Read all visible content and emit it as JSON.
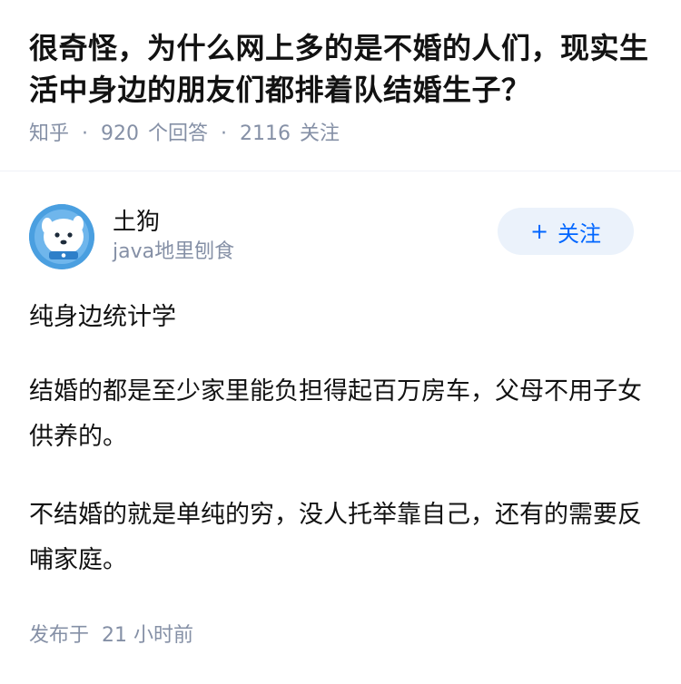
{
  "question": {
    "title": "很奇怪，为什么网上多的是不婚的人们，现实生活中身边的朋友们都排着队结婚生子？",
    "source": "知乎",
    "answer_count": "920",
    "answer_label": "个回答",
    "follower_count": "2116",
    "follower_label": "关注"
  },
  "author": {
    "name": "土狗",
    "headline": "java地里刨食",
    "follow_label": "关注",
    "follow_plus": "+",
    "avatar_icon": "cartoon-dog-avatar"
  },
  "answer": {
    "paragraphs": [
      "纯身边统计学",
      "结婚的都是至少家里能负担得起百万房车，父母不用子女供养的。",
      "不结婚的就是单纯的穷，没人托举靠自己，还有的需要反哺家庭。"
    ],
    "publish_label": "发布于",
    "publish_time": "21 小时前"
  },
  "colors": {
    "accent": "#0066ff",
    "follow_bg": "#ebf2fb",
    "meta_gray": "#8590a6",
    "text": "#121212"
  }
}
